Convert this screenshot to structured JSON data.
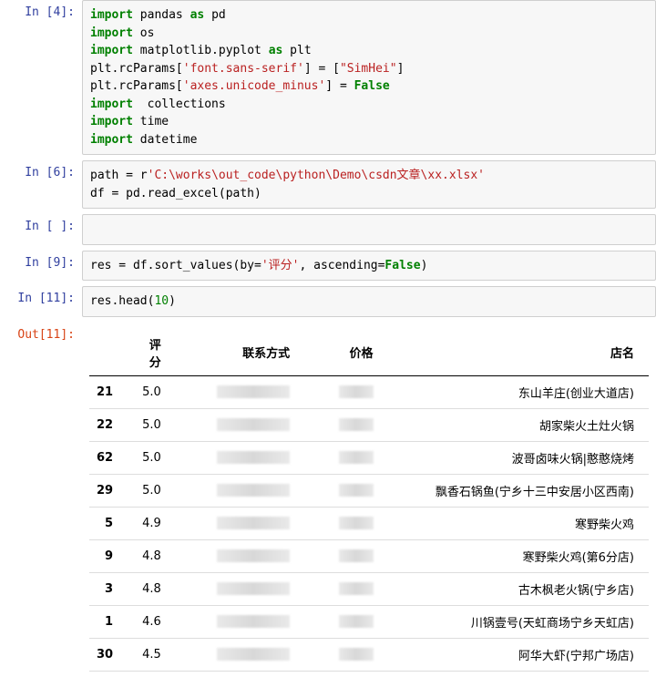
{
  "cells": {
    "c4": {
      "prompt": "In  [4]:",
      "tokens": [
        {
          "t": "import",
          "c": "kw"
        },
        {
          "t": " pandas ",
          "c": "id"
        },
        {
          "t": "as",
          "c": "kw"
        },
        {
          "t": " pd",
          "c": "id"
        },
        {
          "t": "\n",
          "c": ""
        },
        {
          "t": "import",
          "c": "kw"
        },
        {
          "t": " os",
          "c": "id"
        },
        {
          "t": "\n",
          "c": ""
        },
        {
          "t": "import",
          "c": "kw"
        },
        {
          "t": " matplotlib.pyplot ",
          "c": "id"
        },
        {
          "t": "as",
          "c": "kw"
        },
        {
          "t": " plt",
          "c": "id"
        },
        {
          "t": "\n",
          "c": ""
        },
        {
          "t": "plt.rcParams[",
          "c": "id"
        },
        {
          "t": "'font.sans-serif'",
          "c": "str"
        },
        {
          "t": "] = [",
          "c": "id"
        },
        {
          "t": "\"SimHei\"",
          "c": "str"
        },
        {
          "t": "]",
          "c": "id"
        },
        {
          "t": "\n",
          "c": ""
        },
        {
          "t": "plt.rcParams[",
          "c": "id"
        },
        {
          "t": "'axes.unicode_minus'",
          "c": "str"
        },
        {
          "t": "] = ",
          "c": "id"
        },
        {
          "t": "False",
          "c": "kw2"
        },
        {
          "t": "\n",
          "c": ""
        },
        {
          "t": "import",
          "c": "kw"
        },
        {
          "t": "  collections",
          "c": "id"
        },
        {
          "t": "\n",
          "c": ""
        },
        {
          "t": "import",
          "c": "kw"
        },
        {
          "t": " time",
          "c": "id"
        },
        {
          "t": "\n",
          "c": ""
        },
        {
          "t": "import",
          "c": "kw"
        },
        {
          "t": " datetime",
          "c": "id"
        }
      ]
    },
    "c6": {
      "prompt": "In  [6]:",
      "tokens": [
        {
          "t": "path = r",
          "c": "id"
        },
        {
          "t": "'C:\\works\\out_code\\python\\Demo\\csdn文章\\xx.xlsx'",
          "c": "str"
        },
        {
          "t": "\n",
          "c": ""
        },
        {
          "t": "df = pd.read_excel(path)",
          "c": "id"
        }
      ]
    },
    "cEmpty": {
      "prompt": "In  [ ]:",
      "tokens": [
        {
          "t": " ",
          "c": ""
        }
      ]
    },
    "c9": {
      "prompt": "In  [9]:",
      "tokens": [
        {
          "t": "res = df.sort_values(by=",
          "c": "id"
        },
        {
          "t": "'评分'",
          "c": "str"
        },
        {
          "t": ", ascending=",
          "c": "id"
        },
        {
          "t": "False",
          "c": "kw2"
        },
        {
          "t": ")",
          "c": "id"
        }
      ]
    },
    "c11": {
      "prompt": "In [11]:",
      "tokens": [
        {
          "t": "res.head(",
          "c": "id"
        },
        {
          "t": "10",
          "c": "num"
        },
        {
          "t": ")",
          "c": "id"
        }
      ]
    }
  },
  "output11": {
    "prompt": "Out[11]:",
    "columns": [
      "",
      "评分",
      "联系方式",
      "价格",
      "店名"
    ],
    "rows": [
      {
        "idx": "21",
        "rating": "5.0",
        "name": "东山羊庄(创业大道店)"
      },
      {
        "idx": "22",
        "rating": "5.0",
        "name": "胡家柴火土灶火锅"
      },
      {
        "idx": "62",
        "rating": "5.0",
        "name": "波哥卤味火锅|憨憨烧烤"
      },
      {
        "idx": "29",
        "rating": "5.0",
        "name": "飘香石锅鱼(宁乡十三中安居小区西南)"
      },
      {
        "idx": "5",
        "rating": "4.9",
        "name": "寒野柴火鸡"
      },
      {
        "idx": "9",
        "rating": "4.8",
        "name": "寒野柴火鸡(第6分店)"
      },
      {
        "idx": "3",
        "rating": "4.8",
        "name": "古木枫老火锅(宁乡店)"
      },
      {
        "idx": "1",
        "rating": "4.6",
        "name": "川锅壹号(天虹商场宁乡天虹店)"
      },
      {
        "idx": "30",
        "rating": "4.5",
        "name": "阿华大虾(宁邦广场店)"
      }
    ]
  }
}
